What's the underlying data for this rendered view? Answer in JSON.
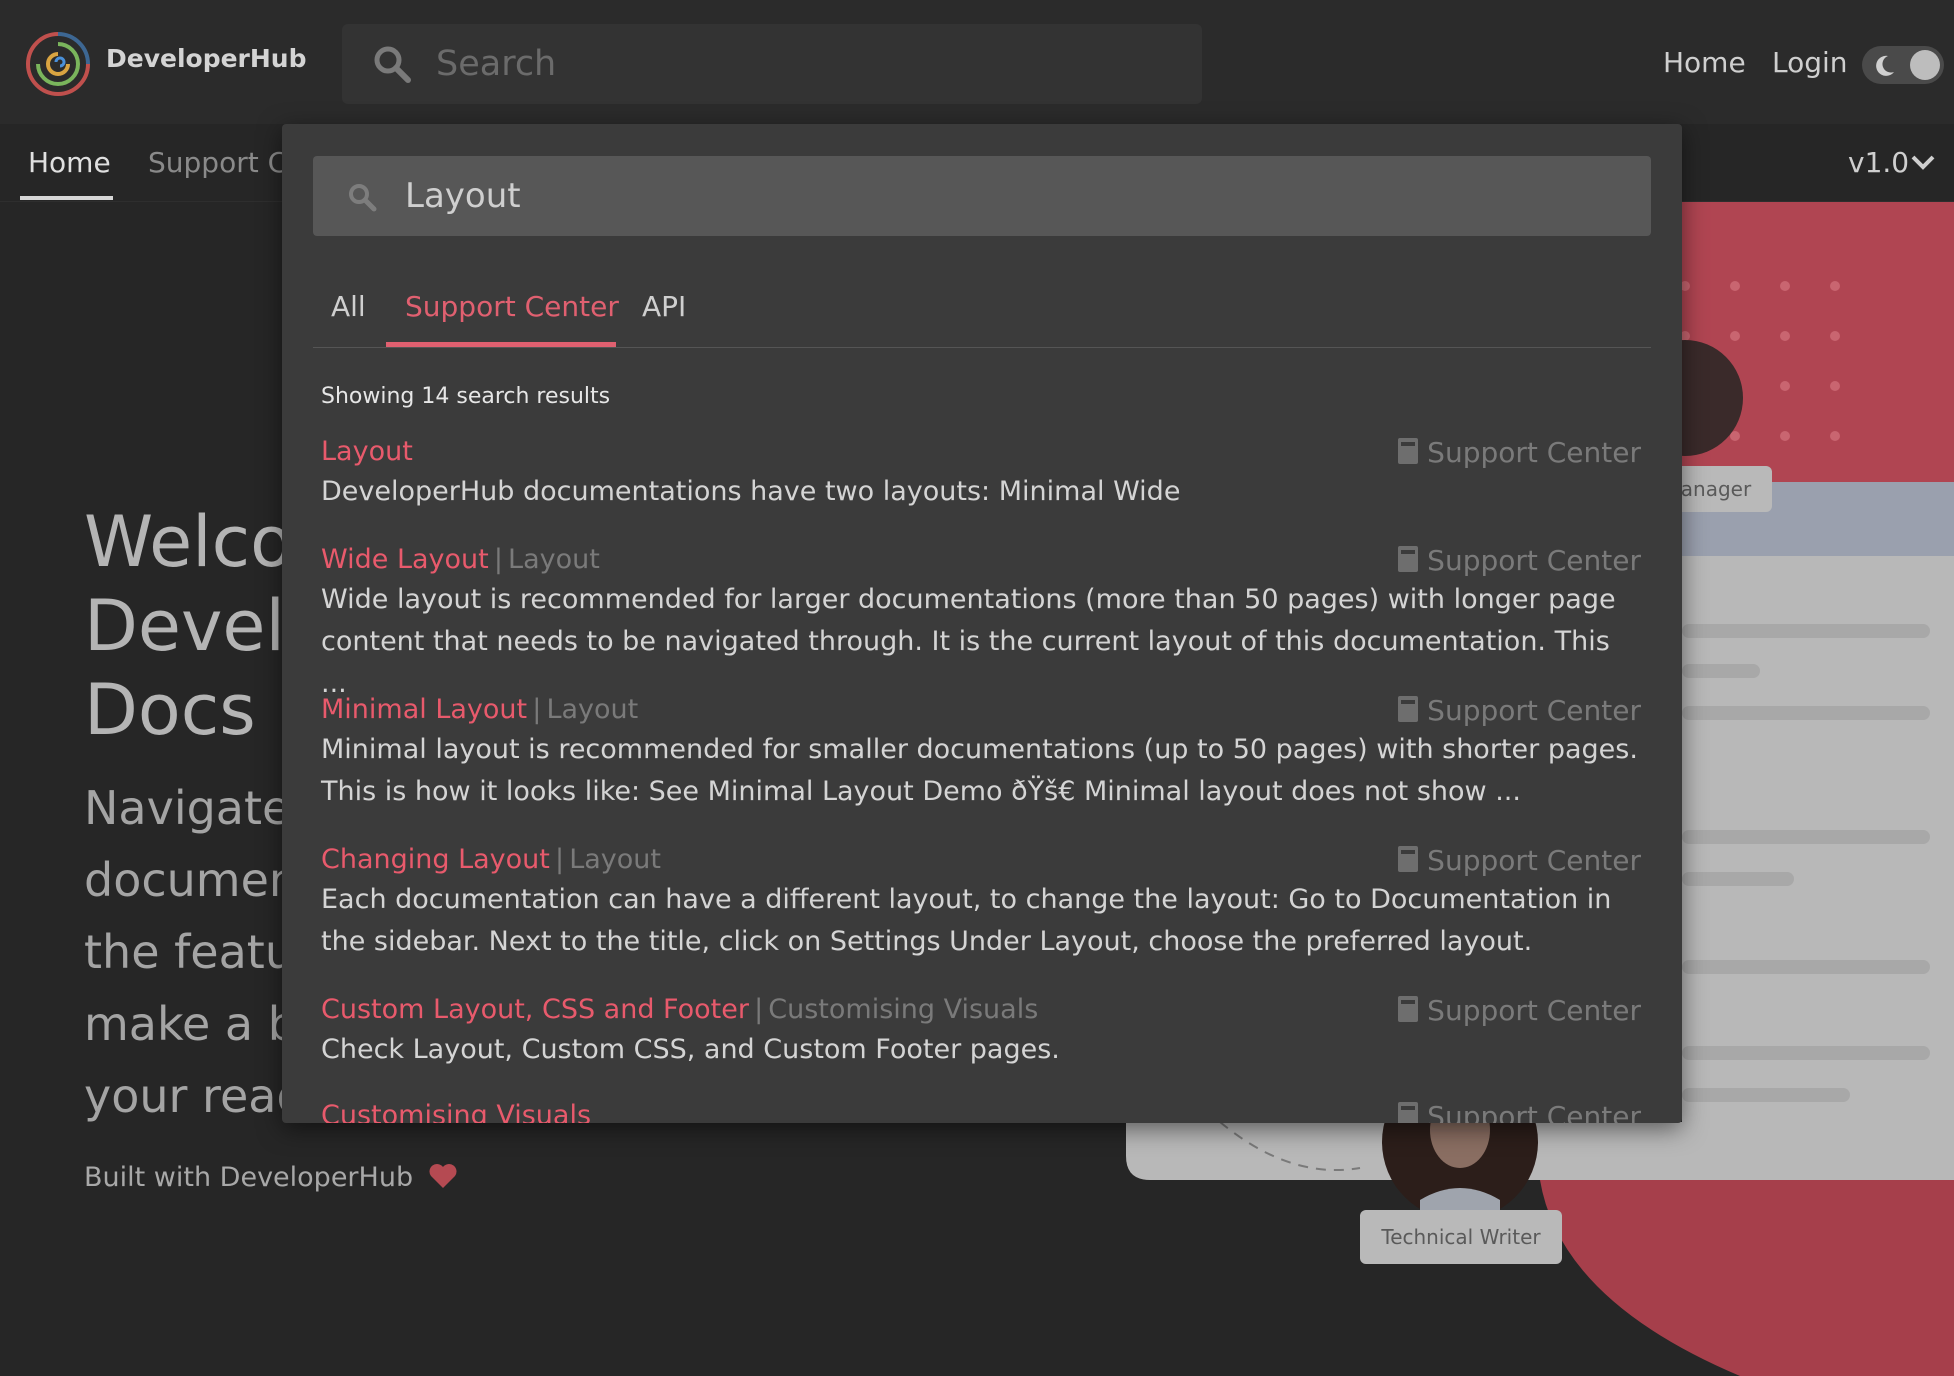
{
  "app": {
    "brand": "DeveloperHub",
    "search_placeholder": "Search",
    "nav": {
      "home": "Home",
      "login": "Login"
    },
    "tabs": {
      "home": "Home",
      "support": "Support Center"
    },
    "version": "v1.0"
  },
  "hero": {
    "title_lines": [
      "Welcome to",
      "DeveloperHub",
      "Docs"
    ],
    "subtitle_lines": [
      "Navigate our",
      "documentation and",
      "the features to",
      "make a better",
      "your readers."
    ],
    "built_with": "Built with DeveloperHub"
  },
  "illustration": {
    "badge_manager": "anager",
    "badge_writer": "Technical Writer"
  },
  "modal": {
    "query": "Layout",
    "tabs": [
      "All",
      "Support Center",
      "API"
    ],
    "active_tab": "Support Center",
    "results_count_text": "Showing 14 search results",
    "results": [
      {
        "title": "Layout",
        "parent": "",
        "category": "Support Center",
        "snippet": "DeveloperHub documentations have two layouts: Minimal Wide"
      },
      {
        "title": "Wide Layout",
        "parent": "Layout",
        "category": "Support Center",
        "snippet": "Wide layout is recommended for larger documentations (more than 50 pages) with longer page content that needs to be navigated through. It is the current layout of this documentation. This ..."
      },
      {
        "title": "Minimal Layout",
        "parent": "Layout",
        "category": "Support Center",
        "snippet": "Minimal layout is recommended for smaller documentations (up to 50 pages) with shorter pages. This is how it looks like: See Minimal Layout Demo ðŸš€ Minimal layout does not show ..."
      },
      {
        "title": "Changing Layout",
        "parent": "Layout",
        "category": "Support Center",
        "snippet": "Each documentation can have a different layout, to change the layout: Go to Documentation in the sidebar. Next to the title, click on Settings Under Layout, choose the preferred layout."
      },
      {
        "title": "Custom Layout, CSS and Footer",
        "parent": "Customising Visuals",
        "category": "Support Center",
        "snippet": "Check Layout, Custom CSS, and Custom Footer pages."
      },
      {
        "title": "Customising Visuals",
        "parent": "",
        "category": "Support Center",
        "snippet": ""
      }
    ]
  },
  "colors": {
    "accent": "#e85a6c",
    "background": "#262626",
    "modal": "#3b3b3b",
    "illustration_red": "#d14a5a"
  },
  "icons": [
    "logo-spiral-icon",
    "search-icon",
    "moon-icon",
    "chevron-down-icon",
    "book-icon",
    "heart-icon"
  ]
}
